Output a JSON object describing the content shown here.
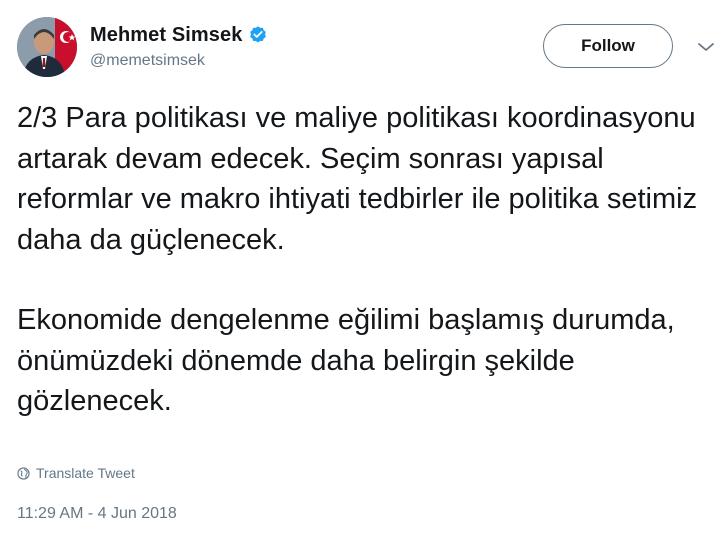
{
  "author": {
    "display_name": "Mehmet Simsek",
    "handle": "@memetsimsek",
    "verified_icon": "verified-badge-icon",
    "avatar_icon": "profile-photo-with-turkish-flag"
  },
  "actions": {
    "follow_label": "Follow",
    "menu_icon": "chevron-down-icon"
  },
  "tweet": {
    "paragraph_1": "2/3 Para politikası ve maliye politikası koordinasyonu artarak devam edecek. Seçim sonrası yapısal reformlar ve makro ihtiyati tedbirler ile politika setimiz daha da güçlenecek.",
    "paragraph_2": "Ekonomide dengelenme eğilimi başlamış durumda, önümüzdeki dönemde daha belirgin şekilde gözlenecek.",
    "translate_label": "Translate Tweet",
    "translate_icon": "globe-icon",
    "timestamp": "11:29 AM - 4 Jun 2018"
  },
  "colors": {
    "text_primary": "#14171a",
    "text_secondary": "#657786",
    "verified_blue": "#1da1f2",
    "background": "#ffffff"
  }
}
